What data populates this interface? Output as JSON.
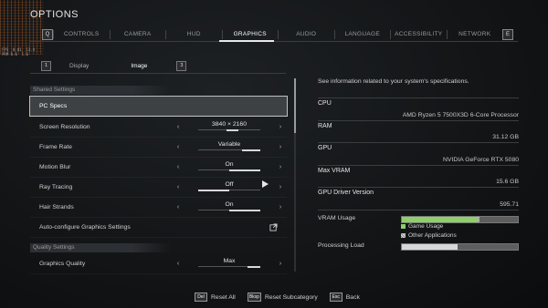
{
  "window": {
    "title": "OPTIONS"
  },
  "overlay": {
    "text": "FPS  0.01  13.4\nPRM 0.0  1.0"
  },
  "tabs": {
    "left_key": "Q",
    "right_key": "E",
    "items": [
      {
        "label": "CONTROLS"
      },
      {
        "label": "CAMERA"
      },
      {
        "label": "HUD"
      },
      {
        "label": "GRAPHICS"
      },
      {
        "label": "AUDIO"
      },
      {
        "label": "LANGUAGE"
      },
      {
        "label": "ACCESSIBILITY"
      },
      {
        "label": "NETWORK"
      }
    ],
    "active": "GRAPHICS"
  },
  "subtabs": {
    "left_key": "1",
    "right_key": "3",
    "items": [
      {
        "label": "Display"
      },
      {
        "label": "Image"
      }
    ],
    "active": "Image"
  },
  "left_panel": {
    "section_shared": "Shared Settings",
    "pc_specs": "PC Specs",
    "rows": [
      {
        "label": "Screen Resolution",
        "value": "3840 × 2160"
      },
      {
        "label": "Frame Rate",
        "value": "Variable"
      },
      {
        "label": "Motion Blur",
        "value": "On"
      },
      {
        "label": "Ray Tracing",
        "value": "Off"
      },
      {
        "label": "Hair Strands",
        "value": "On"
      }
    ],
    "auto_configure": "Auto-configure Graphics Settings",
    "section_quality": "Quality Settings",
    "quality_row": {
      "label": "Graphics Quality",
      "value": "Max"
    }
  },
  "right_panel": {
    "intro": "See information related to your system's specifications.",
    "specs": [
      {
        "key": "CPU",
        "value": "AMD Ryzen 5 7500X3D 6-Core Processor"
      },
      {
        "key": "RAM",
        "value": "31.12 GB"
      },
      {
        "key": "GPU",
        "value": "NVIDIA GeForce RTX 5080"
      },
      {
        "key": "Max VRAM",
        "value": "15.6 GB"
      },
      {
        "key": "GPU Driver Version",
        "value": "595.71"
      }
    ],
    "vram_usage_label": "VRAM Usage",
    "vram_game_fraction": 0.65,
    "vram_other_fraction": 0.02,
    "legend_game": "Game Usage",
    "legend_other": "Other Applications",
    "processing_load_label": "Processing Load",
    "processing_load_fraction": 0.48
  },
  "bottom_bar": {
    "reset_all_key": "Del",
    "reset_all": "Reset All",
    "reset_sub_key": "Bksp",
    "reset_subcategory": "Reset Subcategory",
    "back_key": "Esc",
    "back": "Back"
  },
  "colors": {
    "accent_green": "#8ecf6a",
    "selected_bg": "#3e4144"
  }
}
